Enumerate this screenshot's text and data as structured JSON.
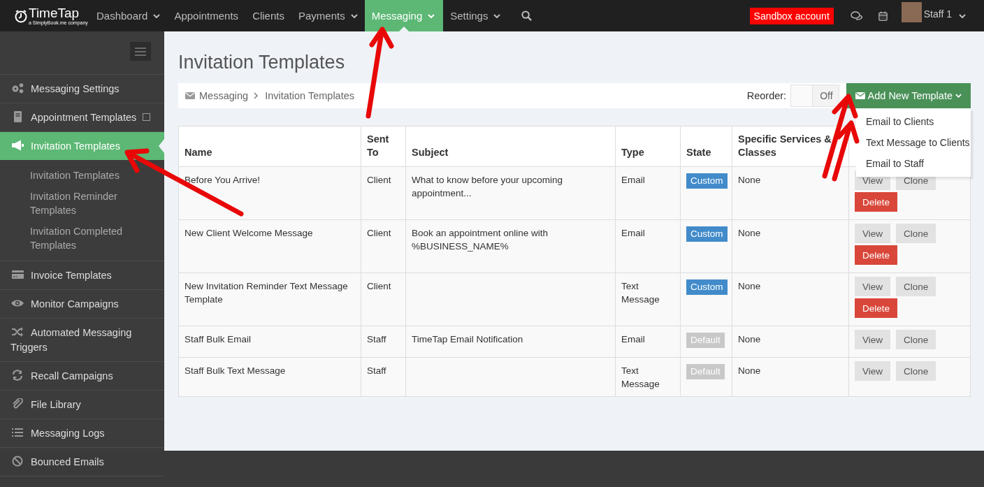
{
  "topbar": {
    "logo": "TimeTap",
    "logo_tagline": "a SimplyBook.me company",
    "nav": [
      {
        "label": "Dashboard",
        "dropdown": true,
        "selected": false
      },
      {
        "label": "Appointments",
        "dropdown": false,
        "selected": false
      },
      {
        "label": "Clients",
        "dropdown": false,
        "selected": false
      },
      {
        "label": "Payments",
        "dropdown": true,
        "selected": false
      },
      {
        "label": "Messaging",
        "dropdown": true,
        "selected": true
      },
      {
        "label": "Settings",
        "dropdown": true,
        "selected": false
      }
    ],
    "sandbox_badge": "Sandbox account",
    "user": "Staff 1"
  },
  "sidebar": {
    "items": [
      {
        "label": "Messaging Settings",
        "selected": false
      },
      {
        "label": "Appointment Templates",
        "selected": false,
        "expandable": true
      },
      {
        "label": "Invitation Templates",
        "selected": true,
        "children": [
          {
            "label": "Invitation Templates"
          },
          {
            "label": "Invitation Reminder Templates"
          },
          {
            "label": "Invitation Completed Templates"
          }
        ]
      },
      {
        "label": "Invoice Templates",
        "selected": false
      },
      {
        "label": "Monitor Campaigns",
        "selected": false
      },
      {
        "label": "Automated Messaging Triggers",
        "selected": false
      },
      {
        "label": "Recall Campaigns",
        "selected": false
      },
      {
        "label": "File Library",
        "selected": false
      },
      {
        "label": "Messaging Logs",
        "selected": false
      },
      {
        "label": "Bounced Emails",
        "selected": false
      }
    ]
  },
  "page_title": "Invitation Templates",
  "breadcrumb": [
    "Messaging",
    "Invitation Templates"
  ],
  "reorder": {
    "label": "Reorder:",
    "value": "Off",
    "on": false
  },
  "add_button": {
    "label": "Add New Template",
    "menu": [
      "Email to Clients",
      "Text Message to Clients",
      "Email to Staff"
    ]
  },
  "table": {
    "columns": [
      "Name",
      "Sent To",
      "Subject",
      "Type",
      "State",
      "Specific Services & Classes",
      ""
    ],
    "rows": [
      {
        "name": "Before You Arrive!",
        "sent_to": "Client",
        "subject": "What to know before your upcoming appointment...",
        "type": "Email",
        "state": {
          "label": "Custom",
          "kind": "custom"
        },
        "services": "None",
        "actions": [
          {
            "label": "View",
            "kind": "plain"
          },
          {
            "label": "Clone",
            "kind": "plain"
          },
          {
            "label": "Delete",
            "kind": "danger"
          }
        ]
      },
      {
        "name": "New Client Welcome Message",
        "sent_to": "Client",
        "subject": "Book an appointment online with %BUSINESS_NAME%",
        "type": "Email",
        "state": {
          "label": "Custom",
          "kind": "custom"
        },
        "services": "None",
        "actions": [
          {
            "label": "View",
            "kind": "plain"
          },
          {
            "label": "Clone",
            "kind": "plain"
          },
          {
            "label": "Delete",
            "kind": "danger"
          }
        ]
      },
      {
        "name": "New Invitation Reminder Text Message Template",
        "sent_to": "Client",
        "subject": "",
        "type": "Text Message",
        "state": {
          "label": "Custom",
          "kind": "custom"
        },
        "services": "None",
        "actions": [
          {
            "label": "View",
            "kind": "plain"
          },
          {
            "label": "Clone",
            "kind": "plain"
          },
          {
            "label": "Delete",
            "kind": "danger"
          }
        ]
      },
      {
        "name": "Staff Bulk Email",
        "sent_to": "Staff",
        "subject": "TimeTap Email Notification",
        "type": "Email",
        "state": {
          "label": "Default",
          "kind": "default"
        },
        "services": "None",
        "actions": [
          {
            "label": "View",
            "kind": "plain"
          },
          {
            "label": "Clone",
            "kind": "plain"
          }
        ]
      },
      {
        "name": "Staff Bulk Text Message",
        "sent_to": "Staff",
        "subject": "",
        "type": "Text Message",
        "state": {
          "label": "Default",
          "kind": "default"
        },
        "services": "None",
        "actions": [
          {
            "label": "View",
            "kind": "plain"
          },
          {
            "label": "Clone",
            "kind": "plain"
          }
        ]
      }
    ]
  }
}
